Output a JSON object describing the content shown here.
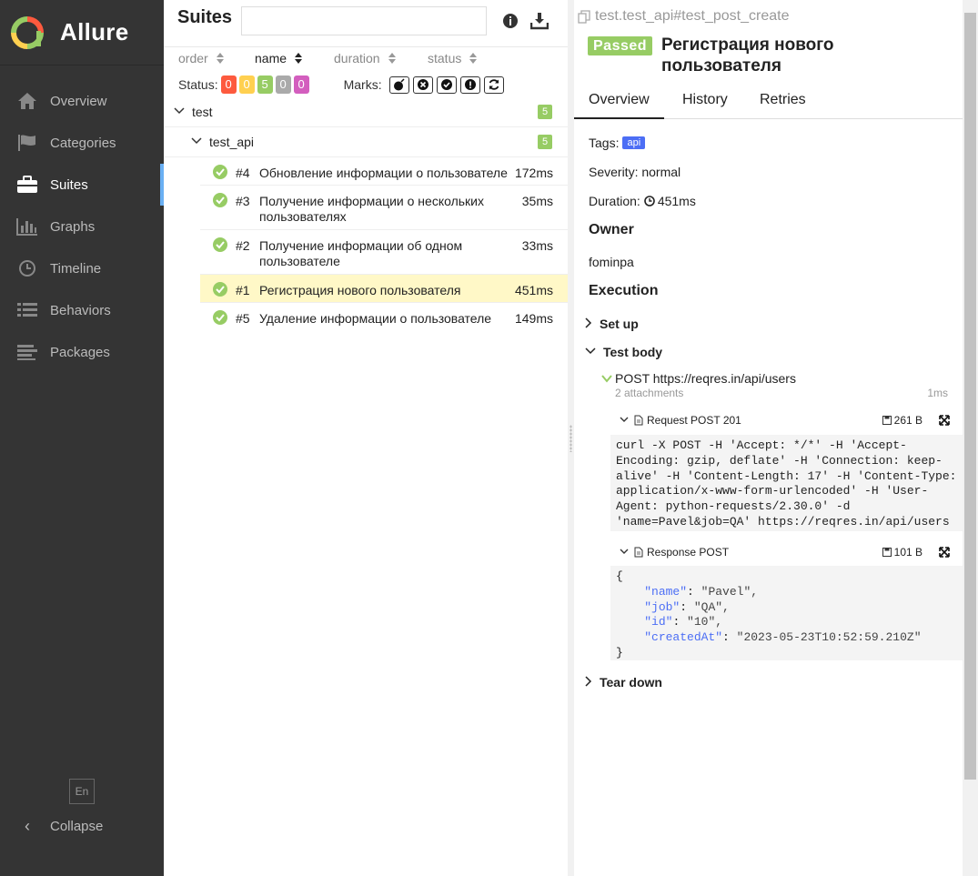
{
  "app": {
    "name": "Allure"
  },
  "sidebar": {
    "items": [
      {
        "label": "Overview",
        "icon": "home-icon"
      },
      {
        "label": "Categories",
        "icon": "flag-icon"
      },
      {
        "label": "Suites",
        "icon": "briefcase-icon"
      },
      {
        "label": "Graphs",
        "icon": "bar-chart-icon"
      },
      {
        "label": "Timeline",
        "icon": "clock-icon"
      },
      {
        "label": "Behaviors",
        "icon": "list-icon"
      },
      {
        "label": "Packages",
        "icon": "align-left-icon"
      }
    ],
    "active": "Suites",
    "lang": "En",
    "collapse_label": "Collapse"
  },
  "suites": {
    "title": "Suites",
    "search_value": "",
    "sort": {
      "order": "order",
      "name": "name",
      "duration": "duration",
      "status": "status"
    },
    "status_label": "Status:",
    "status_counts": [
      {
        "value": "0",
        "color": "#fd5a3e"
      },
      {
        "value": "0",
        "color": "#ffd050"
      },
      {
        "value": "5",
        "color": "#97cc64"
      },
      {
        "value": "0",
        "color": "#aaaaaa"
      },
      {
        "value": "0",
        "color": "#d35ebe"
      }
    ],
    "marks_label": "Marks:",
    "groups": [
      {
        "name": "test",
        "count": "5"
      },
      {
        "name": "test_api",
        "count": "5"
      }
    ],
    "tests": [
      {
        "num": "#4",
        "name": "Обновление информации о пользователе",
        "duration": "172ms"
      },
      {
        "num": "#3",
        "name": "Получение информации о нескольких пользователях",
        "duration": "35ms"
      },
      {
        "num": "#2",
        "name": "Получение информации об одном пользователе",
        "duration": "33ms"
      },
      {
        "num": "#1",
        "name": "Регистрация нового пользователя",
        "duration": "451ms"
      },
      {
        "num": "#5",
        "name": "Удаление информации о пользователе",
        "duration": "149ms"
      }
    ]
  },
  "detail": {
    "path": "test.test_api#test_post_create",
    "status": "Passed",
    "title": "Регистрация нового пользователя",
    "tabs": [
      "Overview",
      "History",
      "Retries"
    ],
    "tags_label": "Tags:",
    "tag": "api",
    "severity": "Severity: normal",
    "duration_label": "Duration:",
    "duration": "451ms",
    "owner_heading": "Owner",
    "owner": "fominpa",
    "execution_heading": "Execution",
    "setup": "Set up",
    "test_body": "Test body",
    "request_step": "POST https://reqres.in/api/users",
    "attachments_count": "2 attachments",
    "step_duration": "1ms",
    "attachment1": {
      "title": "Request POST 201",
      "size": "261 B"
    },
    "attachment1_code": "curl -X POST -H 'Accept: */*' -H 'Accept-\nEncoding: gzip, deflate' -H 'Connection: keep-\nalive' -H 'Content-Length: 17' -H 'Content-Type:\napplication/x-www-form-urlencoded' -H 'User-\nAgent: python-requests/2.30.0' -d\n'name=Pavel&job=QA' https://reqres.in/api/users",
    "attachment2": {
      "title": "Response POST",
      "size": "101 B"
    },
    "json_open": "{",
    "json_close": "}",
    "json_lines": [
      {
        "key": "\"name\"",
        "value": "\"Pavel\","
      },
      {
        "key": "\"job\"",
        "value": "\"QA\","
      },
      {
        "key": "\"id\"",
        "value": "\"10\","
      },
      {
        "key": "\"createdAt\"",
        "value": "\"2023-05-23T10:52:59.210Z\""
      }
    ],
    "teardown": "Tear down"
  }
}
